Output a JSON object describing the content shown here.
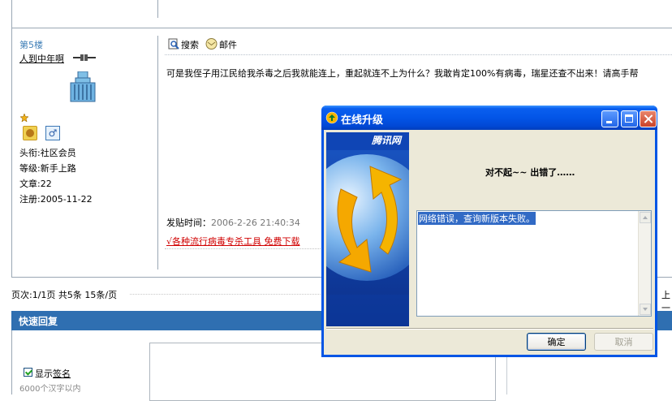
{
  "post": {
    "floor": "第5楼",
    "username": "人到中年啊",
    "title_label": "头衔:",
    "title_value": "社区会员",
    "level_label": "等级:",
    "level_value": "新手上路",
    "articles_label": "文章:",
    "articles_value": "22",
    "register_label": "注册:",
    "register_value": "2005-11-22",
    "search_label": "搜索",
    "mail_label": "邮件",
    "content": "可是我侄子用江民给我杀毒之后我就能连上，重起就连不上为什么？我敢肯定100%有病毒，瑞星还查不出来！请高手帮",
    "time_label": "发贴时间：",
    "time_value": "2006-2-26 21:40:34",
    "ad_link": "√各种流行病毒专杀工具 免费下载"
  },
  "pager": {
    "text": "页次:1/1页 共5条 15条/页",
    "right_fragment": "上一"
  },
  "quick_reply": {
    "title": "快速回复",
    "show_sig_prefix": "显示",
    "show_sig_underlined": "签名",
    "sig_hint": "6000个汉字以内"
  },
  "dialog": {
    "title": "在线升级",
    "banner_text": "腾讯网",
    "error_title": "对不起~~ 出错了……",
    "error_message": "网络错误，查询新版本失败。",
    "ok_label": "确定",
    "cancel_label": "取消"
  },
  "colors": {
    "accent_blue": "#2f6fb1",
    "titlebar_blue": "#0355e7",
    "link_red": "#d00000",
    "floor_blue": "#3f7fb7",
    "selection_blue": "#316ac5"
  }
}
